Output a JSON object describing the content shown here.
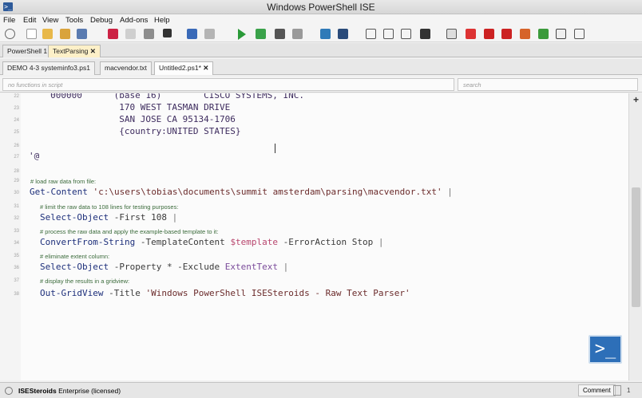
{
  "window": {
    "title": "Windows PowerShell ISE",
    "app_icon": "ps-icon"
  },
  "menu": [
    "File",
    "Edit",
    "View",
    "Tools",
    "Debug",
    "Add-ons",
    "Help"
  ],
  "run_tabs": [
    {
      "label": "PowerShell 1",
      "active": false
    },
    {
      "label": "TextParsing",
      "active": true,
      "close": "✕"
    }
  ],
  "script_tabs": [
    {
      "label": "DEMO 4-3 systeminfo3.ps1",
      "active": false
    },
    {
      "label": "macvendor.txt",
      "active": false
    },
    {
      "label": "Untitled2.ps1*",
      "active": true,
      "close": "✕"
    }
  ],
  "filters": {
    "functions_placeholder": "no functions in script",
    "search_placeholder": "search"
  },
  "editor": {
    "lines": [
      {
        "n": "22",
        "text": "     000000      (base 16)        CISCO SYSTEMS, INC."
      },
      {
        "n": "23",
        "text": "                  170 WEST TASMAN DRIVE"
      },
      {
        "n": "24",
        "text": "                  SAN JOSE CA 95134-1706"
      },
      {
        "n": "25",
        "text": "                  {country:UNITED STATES}"
      },
      {
        "n": "26",
        "text": ""
      },
      {
        "n": "27",
        "text": "'@"
      },
      {
        "n": "28",
        "text": ""
      },
      {
        "n": "29",
        "comment": "# load raw data from file:"
      },
      {
        "n": "30",
        "cmd": "Get-Content",
        "rest": " 'c:\\users\\tobias\\documents\\summit amsterdam\\parsing\\macvendor.txt'",
        "pipe": " |"
      },
      {
        "n": "31",
        "comment": "# limit the raw data to 108 lines for testing purposes:"
      },
      {
        "n": "32",
        "cmd": "Select-Object",
        "rest": " -First 108",
        "pipe": " |"
      },
      {
        "n": "33",
        "comment": "# process the raw data and apply the example-based template to it:"
      },
      {
        "n": "34",
        "cmd": "ConvertFrom-String",
        "rest": " -TemplateContent ",
        "var": "$template",
        "rest2": " -ErrorAction Stop",
        "pipe": " |"
      },
      {
        "n": "35",
        "comment": "# eliminate extent column:"
      },
      {
        "n": "36",
        "cmd": "Select-Object",
        "rest": " -Property * -Exclude ",
        "var": "ExtentText",
        "pipe": " |"
      },
      {
        "n": "37",
        "comment": "# display the results in a gridview:"
      },
      {
        "n": "38",
        "cmd": "Out-GridView",
        "rest": " -Title ",
        "str": "'Windows PowerShell ISESteroids - Raw Text Parser'"
      }
    ]
  },
  "status": {
    "product": "ISESteroids",
    "license": " Enterprise (licensed)",
    "comment_btn": "Comment",
    "zoom_value": "1"
  }
}
